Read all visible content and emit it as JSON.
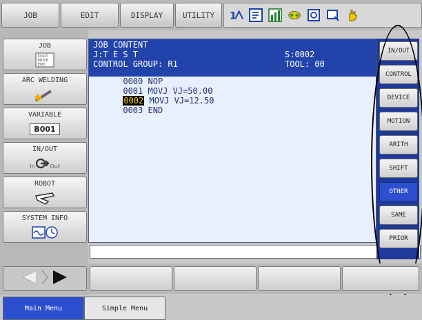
{
  "menu": {
    "job": "JOB",
    "edit": "EDIT",
    "display": "DISPLAY",
    "utility": "UTILITY"
  },
  "toolbar_icons": [
    "number-switch-icon",
    "edit-box-icon",
    "chart-icon",
    "tool-interlock-icon",
    "monitor-icon",
    "screen-icon",
    "hand-icon"
  ],
  "left": {
    "job": {
      "label": "JOB",
      "icon_text": "DOUT\nMOVE\nEND"
    },
    "arc_welding": {
      "label": "ARC WELDING"
    },
    "variable": {
      "label": "VARIABLE",
      "value": "B001"
    },
    "in_out": {
      "label": "IN/OUT",
      "in": "In",
      "out": "Out"
    },
    "robot": {
      "label": "ROBOT"
    },
    "system_info": {
      "label": "SYSTEM INFO"
    }
  },
  "job_content": {
    "title": "JOB CONTENT",
    "job_name": "J:T E S T",
    "step": "S:0002",
    "control_group": "CONTROL GROUP: R1",
    "tool": "TOOL: 00",
    "lines": [
      {
        "num": "0000",
        "text": "NOP",
        "selected": false
      },
      {
        "num": "0001",
        "text": "MOVJ VJ=50.00",
        "selected": false
      },
      {
        "num": "0002",
        "text": "MOVJ VJ=12.50",
        "selected": true
      },
      {
        "num": "0003",
        "text": "END",
        "selected": false
      }
    ]
  },
  "right_menu": [
    {
      "label": "IN/OUT",
      "active": false
    },
    {
      "label": "CONTROL",
      "active": false
    },
    {
      "label": "DEVICE",
      "active": false
    },
    {
      "label": "MOTION",
      "active": false
    },
    {
      "label": "ARITH",
      "active": false
    },
    {
      "label": "SHIFT",
      "active": false
    },
    {
      "label": "OTHER",
      "active": true
    },
    {
      "label": "SAME",
      "active": false
    },
    {
      "label": "PRIOR",
      "active": false
    }
  ],
  "tabs": {
    "main": "Main Menu",
    "simple": "Simple Menu"
  },
  "colors": {
    "header_blue": "#2244aa",
    "active_blue": "#2c4fd0",
    "selection_yellow": "#ffd000"
  }
}
